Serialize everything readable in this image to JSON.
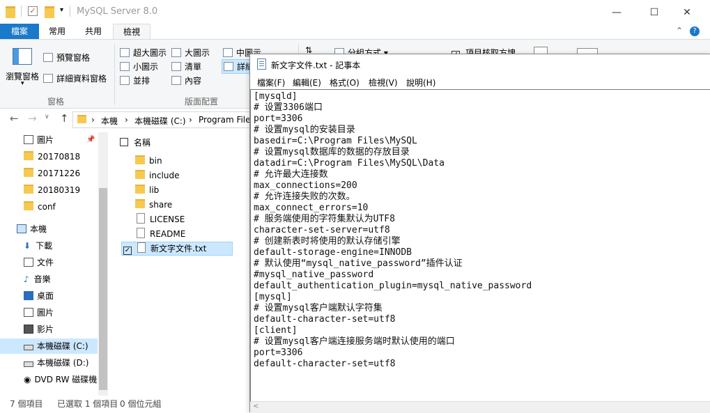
{
  "explorer": {
    "title": "MySQL Server 8.0",
    "window_controls": {
      "minimize": "—",
      "maximize": "☐",
      "close": "✕"
    },
    "ribbon_tabs": [
      "檔案",
      "常用",
      "共用",
      "檢視"
    ],
    "ribbon": {
      "navigation_pane": "瀏覽窗格",
      "preview_pane": "預覽窗格",
      "details_pane": "詳細資料窗格",
      "group_panes": "窗格",
      "layout_items": [
        "超大圖示",
        "大圖示",
        "中圖示",
        "小圖示",
        "清單",
        "詳細",
        "並排",
        "內容"
      ],
      "group_layout": "版面配置",
      "sort_by": "分組方式",
      "item_checkboxes": "項目核取方塊",
      "help": "?"
    },
    "address": {
      "crumbs": [
        "本機",
        "本機磁碟 (C:)",
        "Program Files"
      ]
    },
    "nav_pane": {
      "pinned": [
        "圖片",
        "20170818",
        "20171226",
        "20180319",
        "conf"
      ],
      "this_pc": "本機",
      "pc_items": [
        "下載",
        "文件",
        "音樂",
        "桌面",
        "圖片",
        "影片",
        "本機磁碟 (C:)",
        "本機磁碟 (D:)",
        "DVD RW 磁碟機"
      ]
    },
    "content": {
      "column_header": "名稱",
      "items": [
        "bin",
        "include",
        "lib",
        "share",
        "LICENSE",
        "README",
        "新文字文件.txt"
      ]
    },
    "status": {
      "count": "7 個項目",
      "selected": "已選取 1 個項目",
      "size": "0 個位元組"
    }
  },
  "notepad": {
    "title": "新文字文件.txt - 記事本",
    "menu": [
      "檔案(F)",
      "編輯(E)",
      "格式(O)",
      "檢視(V)",
      "說明(H)"
    ],
    "content": "[mysqld]\n# 设置3306端口\nport=3306\n# 设置mysql的安装目录\nbasedir=C:\\Program Files\\MySQL\n# 设置mysql数据库的数据的存放目录\ndatadir=C:\\Program Files\\MySQL\\Data\n# 允许最大连接数\nmax_connections=200\n# 允许连接失败的次数。\nmax_connect_errors=10\n# 服务端使用的字符集默认为UTF8\ncharacter-set-server=utf8\n# 创建新表时将使用的默认存储引擎\ndefault-storage-engine=INNODB\n# 默认使用“mysql_native_password”插件认证\n#mysql_native_password\ndefault_authentication_plugin=mysql_native_password\n[mysql]\n# 设置mysql客户端默认字符集\ndefault-character-set=utf8\n[client]\n# 设置mysql客户端连接服务端时默认使用的端口\nport=3306\ndefault-character-set=utf8"
  }
}
